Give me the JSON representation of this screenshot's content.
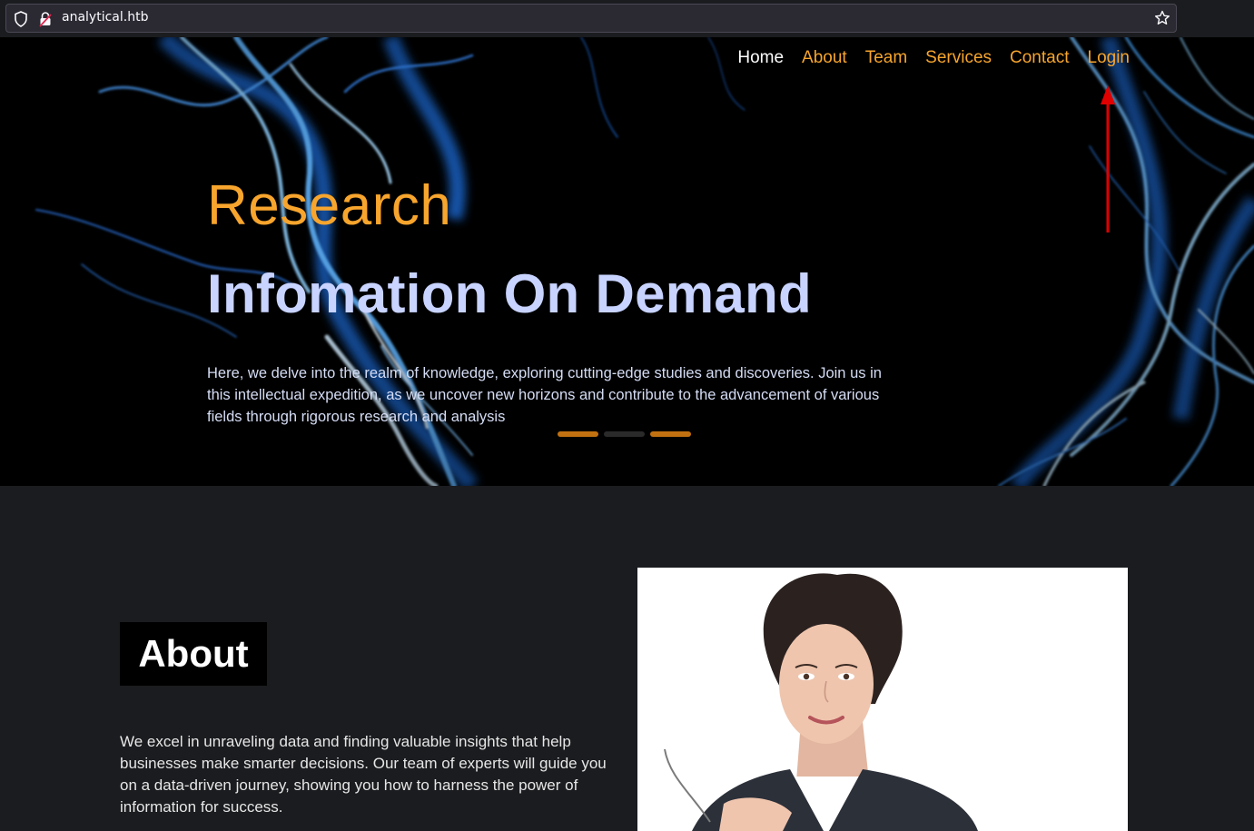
{
  "browser": {
    "url": "analytical.htb",
    "icons": [
      "shield-icon",
      "lock-icon",
      "bookmark-star-icon"
    ]
  },
  "nav": {
    "home": "Home",
    "about": "About",
    "team": "Team",
    "services": "Services",
    "contact": "Contact",
    "login": "Login"
  },
  "hero": {
    "kicker": "Research",
    "headline": "Infomation On Demand",
    "lede": "Here, we delve into the realm of knowledge, exploring cutting-edge studies and discoveries. Join us in this intellectual expedition, as we uncover new horizons and contribute to the advancement of various fields through rigorous research and analysis",
    "slides_total": 3,
    "slides_state": [
      "active",
      "inactive",
      "active"
    ]
  },
  "about": {
    "title": "About",
    "text": "We excel in unraveling data and finding valuable insights that help businesses make smarter decisions. Our team of experts will guide you on a data-driven journey, showing you how to harness the power of information for success."
  },
  "colors": {
    "accent": "#f7a52d",
    "headline": "#c8d3ff",
    "annotation_arrow": "#e00000"
  }
}
